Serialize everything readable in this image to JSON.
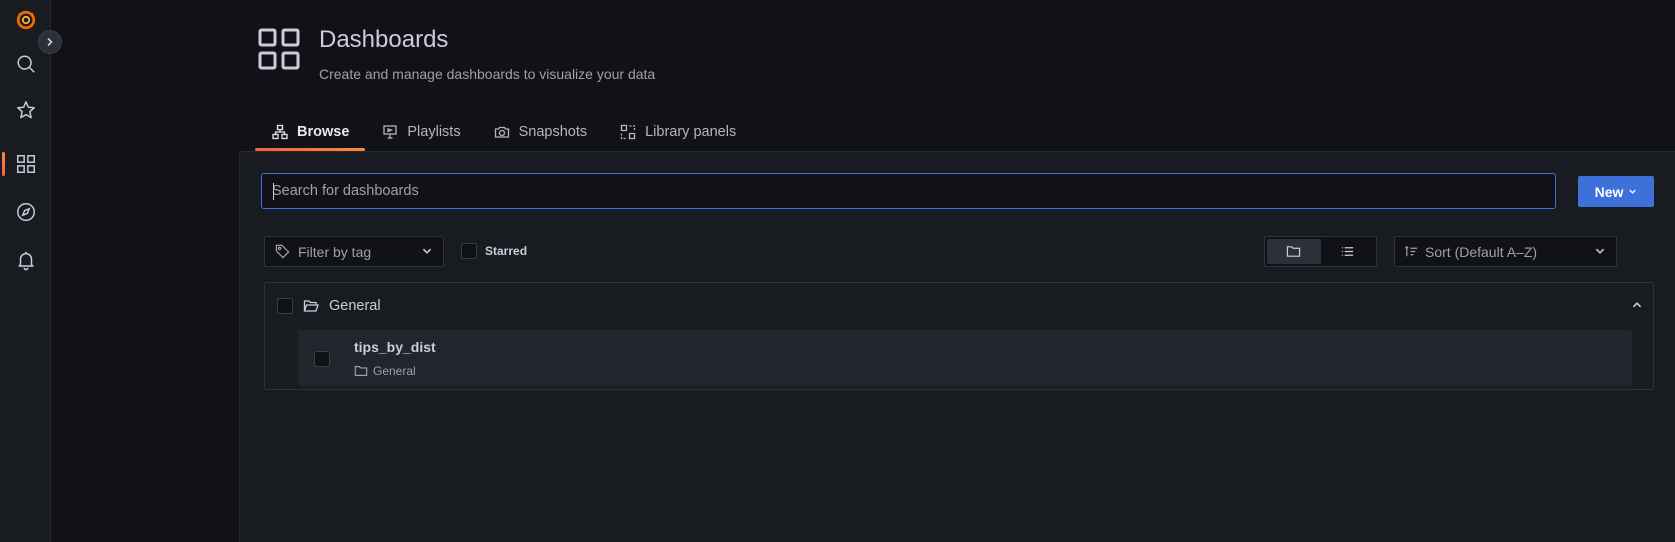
{
  "app": {
    "brand_color": "#f46800",
    "accent": "#3d71d9"
  },
  "sidenav": {
    "items": [
      {
        "name": "grafana-logo-icon",
        "active": false
      },
      {
        "name": "search-icon",
        "active": false
      },
      {
        "name": "star-icon",
        "active": false
      },
      {
        "name": "dashboards-grid-icon",
        "active": true
      },
      {
        "name": "explore-compass-icon",
        "active": false
      },
      {
        "name": "alerting-bell-icon",
        "active": false
      }
    ]
  },
  "header": {
    "title": "Dashboards",
    "subtitle": "Create and manage dashboards to visualize your data"
  },
  "tabs": [
    {
      "label": "Browse",
      "icon": "sitemap-icon",
      "active": true
    },
    {
      "label": "Playlists",
      "icon": "presentation-icon",
      "active": false
    },
    {
      "label": "Snapshots",
      "icon": "camera-icon",
      "active": false
    },
    {
      "label": "Library panels",
      "icon": "library-panel-icon",
      "active": false
    }
  ],
  "search": {
    "placeholder": "Search for dashboards",
    "value": ""
  },
  "new_button": {
    "label": "New"
  },
  "filters": {
    "tag_placeholder": "Filter by tag",
    "starred_label": "Starred",
    "view_mode": "folders",
    "sort_label": "Sort (Default A–Z)"
  },
  "folders": [
    {
      "name": "General",
      "expanded": true,
      "dashboards": [
        {
          "title": "tips_by_dist",
          "folder": "General"
        }
      ]
    }
  ]
}
